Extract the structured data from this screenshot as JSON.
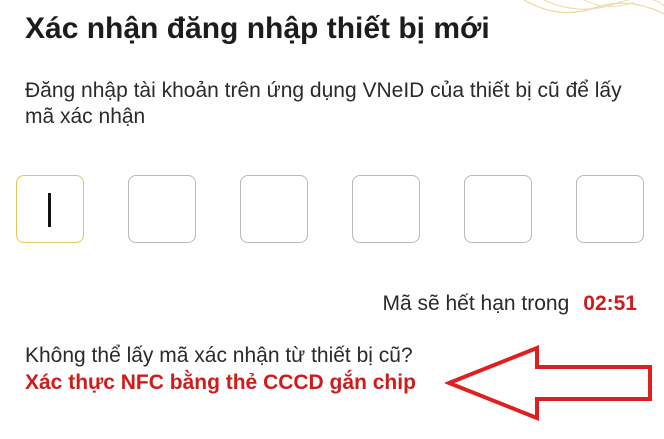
{
  "screen": {
    "title": "Xác nhận đăng nhập thiết bị mới",
    "description": "Đăng nhập tài khoản trên ứng dụng VNeID của thiết bị cũ để lấy mã xác nhận"
  },
  "otp": {
    "length": 6,
    "digits": [
      "",
      "",
      "",
      "",
      "",
      ""
    ],
    "active_index": 0
  },
  "expiry": {
    "label": "Mã sẽ hết hạn trong",
    "countdown": "02:51"
  },
  "fallback": {
    "question": "Không thể lấy mã xác nhận từ thiết bị cũ?",
    "link_label": "Xác thực NFC bằng thẻ CCCD gắn chip"
  },
  "colors": {
    "accent_red": "#d01b1b",
    "active_border": "#e3c657",
    "box_border": "#b9b9b9",
    "annotation_arrow": "#e02020"
  },
  "icons": {
    "annotation": "arrow-left-outline-icon"
  }
}
